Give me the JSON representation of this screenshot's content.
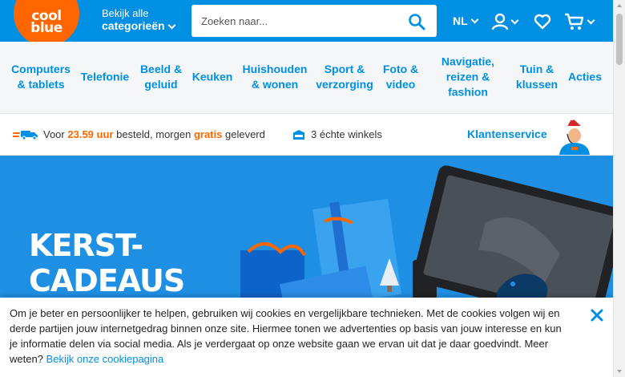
{
  "header": {
    "logo": {
      "line1": "cool",
      "line2": "blue"
    },
    "categories": {
      "small": "Bekijk alle",
      "big": "categorieën"
    },
    "search": {
      "placeholder": "Zoeken naar..."
    },
    "language": "NL",
    "icons": [
      "search-icon",
      "user-icon",
      "heart-icon",
      "cart-icon"
    ]
  },
  "nav": {
    "items": [
      "Computers\n& tablets",
      "Telefonie",
      "Beeld &\ngeluid",
      "Keuken",
      "Huishouden\n& wonen",
      "Sport &\nverzorging",
      "Foto &\nvideo",
      "Navigatie,\nreizen &\nfashion",
      "Tuin &\nklussen",
      "Acties"
    ]
  },
  "usp": {
    "delivery": {
      "prefix": "Voor",
      "time": "23.59 uur",
      "mid": "besteld, morgen",
      "free": "gratis",
      "suffix": "geleverd"
    },
    "stores": "3 échte winkels",
    "customer_service": "Klantenservice"
  },
  "hero": {
    "line1": "KERST-",
    "line2": "CADEAUS",
    "dot": "."
  },
  "cookie": {
    "text": "Om je beter en persoonlijker te helpen, gebruiken wij cookies en vergelijkbare technieken. Met de cookies volgen wij en derde partijen jouw internetgedrag binnen onze site. Hiermee tonen we advertenties op basis van jouw interesse en kun je informatie delen via social media. Als je verdergaat op onze website gaan we ervan uit dat je daar goedvindt. Meer weten?",
    "link": "Bekijk onze cookiepagina"
  },
  "colors": {
    "brand_blue": "#0090e3",
    "brand_orange": "#ff6600",
    "hero_blue": "#1e8fe3"
  }
}
